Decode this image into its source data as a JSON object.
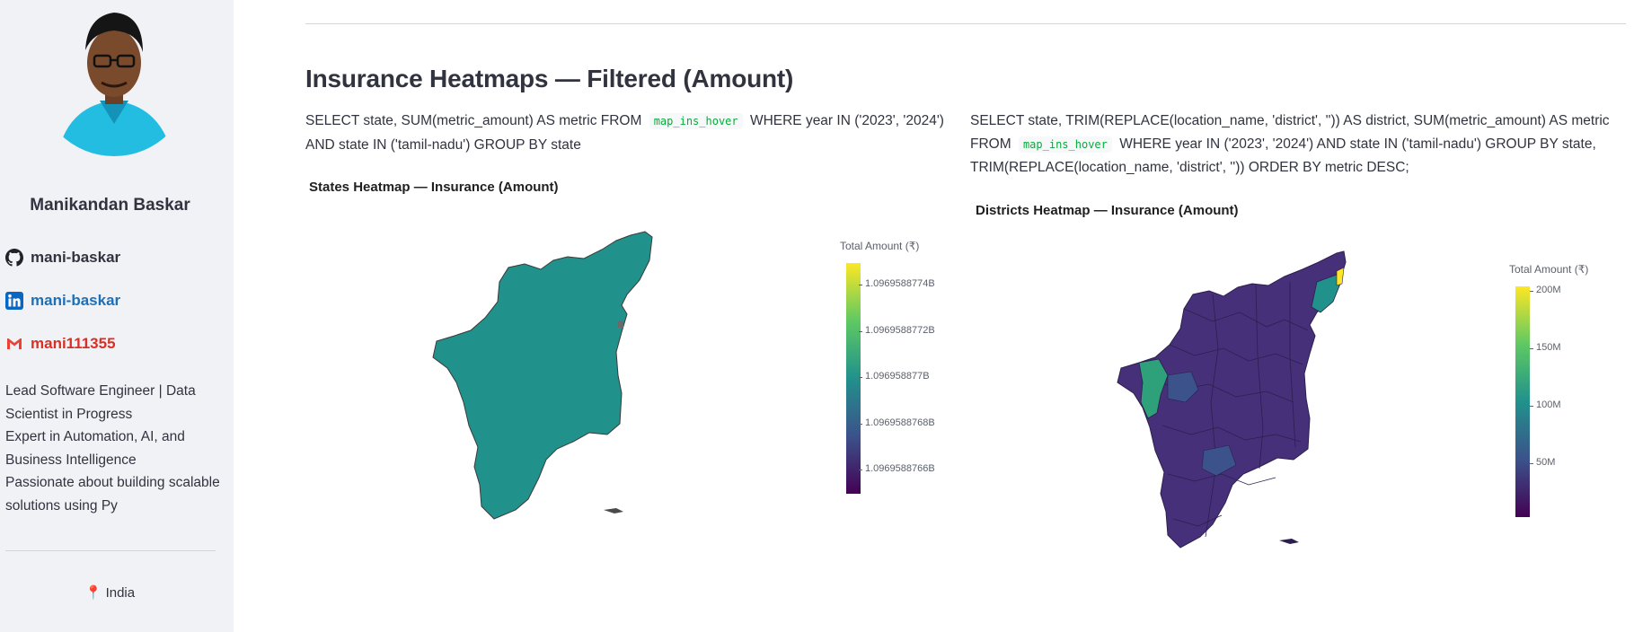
{
  "sidebar": {
    "name": "Manikandan Baskar",
    "github": "mani-baskar",
    "linkedin": "mani-baskar",
    "gmail": "mani111355",
    "bio": [
      "Lead Software Engineer | Data",
      "Scientist in Progress",
      "Expert in Automation, AI, and",
      "Business Intelligence",
      "Passionate about building scalable",
      "solutions using Py"
    ],
    "location": "India"
  },
  "main": {
    "title": "Insurance Heatmaps — Filtered (Amount)",
    "left": {
      "sql_before": "SELECT state, SUM(metric_amount) AS metric FROM",
      "sql_code": "map_ins_hover",
      "sql_after": "WHERE year IN ('2023', '2024') AND state IN ('tamil-nadu') GROUP BY state",
      "chart_title": "States Heatmap — Insurance (Amount)",
      "colorbar_title": "Total Amount (₹)",
      "ticks": [
        "1.0969588774B",
        "1.0969588772B",
        "1.096958877B",
        "1.0969588768B",
        "1.0969588766B"
      ]
    },
    "right": {
      "sql_before": "SELECT state, TRIM(REPLACE(location_name, 'district', '')) AS district, SUM(metric_amount) AS metric FROM",
      "sql_code": "map_ins_hover",
      "sql_after": "WHERE year IN ('2023', '2024') AND state IN ('tamil-nadu') GROUP BY state, TRIM(REPLACE(location_name, 'district', '')) ORDER BY metric DESC;",
      "chart_title": "Districts Heatmap — Insurance (Amount)",
      "colorbar_title": "Total Amount (₹)",
      "ticks": [
        "200M",
        "150M",
        "100M",
        "50M"
      ]
    }
  },
  "colors": {
    "sidebar_bg": "#f0f2f6",
    "viridis_low": "#440154",
    "viridis_mid": "#21918c",
    "viridis_high": "#fde725",
    "state_fill": "#21918c",
    "linkedin": "#1d6fb8",
    "gmail": "#d93025"
  },
  "icons": {
    "github": "github-icon",
    "linkedin": "linkedin-icon",
    "gmail": "gmail-icon",
    "location": "pin-icon"
  }
}
